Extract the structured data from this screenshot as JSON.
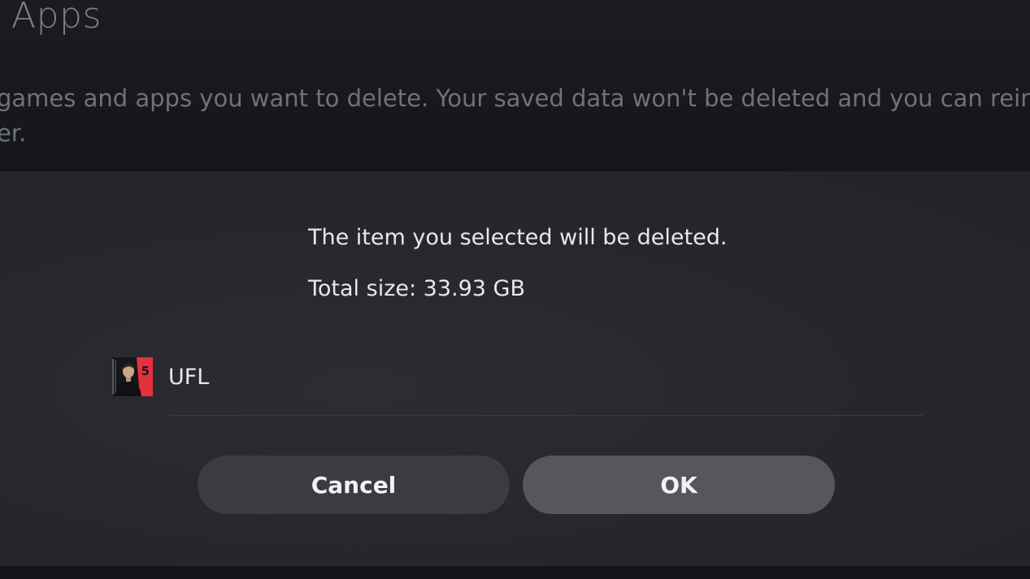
{
  "background": {
    "title": "Apps",
    "description_line1": "games and apps you want to delete. Your saved data won't be deleted and you can reinstall yo",
    "description_line2": "er."
  },
  "dialog": {
    "message": "The item you selected will be deleted.",
    "total_size_label": "Total size: 33.93 GB",
    "items": [
      {
        "label": "UFL",
        "thumbnail_icon": "ufl-game-thumbnail",
        "thumbnail_badge": "5"
      }
    ],
    "buttons": {
      "cancel_label": "Cancel",
      "ok_label": "OK"
    }
  },
  "colors": {
    "accent_red": "#e5303e",
    "button_focused": "#56575d",
    "button_normal": "#3b3c42"
  }
}
